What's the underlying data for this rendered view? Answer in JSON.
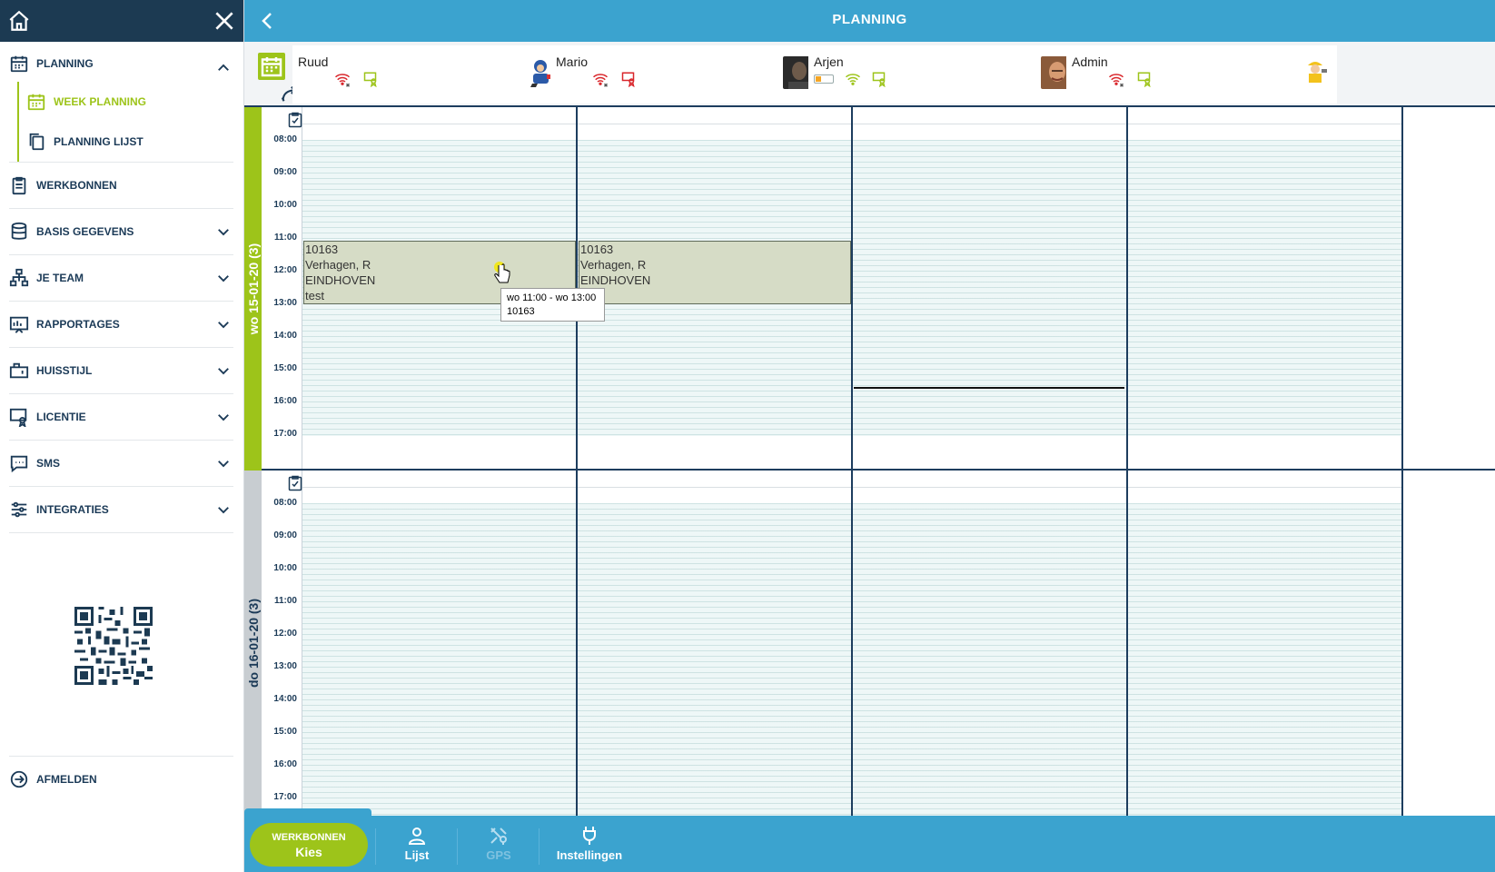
{
  "header": {
    "title": "PLANNING"
  },
  "sidebar": {
    "menu_top": {
      "label": "PLANNING"
    },
    "sub_items": [
      {
        "label": "WEEK PLANNING",
        "active": true
      },
      {
        "label": "PLANNING LIJST",
        "active": false
      }
    ],
    "items": [
      {
        "label": "WERKBONNEN",
        "expandable": false
      },
      {
        "label": "BASIS GEGEVENS",
        "expandable": true
      },
      {
        "label": "JE TEAM",
        "expandable": true
      },
      {
        "label": "RAPPORTAGES",
        "expandable": true
      },
      {
        "label": "HUISSTIJL",
        "expandable": true
      },
      {
        "label": "LICENTIE",
        "expandable": true
      },
      {
        "label": "SMS",
        "expandable": true
      },
      {
        "label": "INTEGRATIES",
        "expandable": true
      }
    ],
    "logout": {
      "label": "AFMELDEN"
    }
  },
  "resources": [
    {
      "name": "Ruud",
      "wifi": "off",
      "device": "red-off",
      "avatar": "cartoon-worker"
    },
    {
      "name": "Mario",
      "wifi": "off",
      "device": "red",
      "avatar": "photo-dark"
    },
    {
      "name": "Arjen",
      "wifi": "on",
      "device": "green",
      "battery": "low",
      "avatar": "photo-face"
    },
    {
      "name": "Admin",
      "wifi": "off",
      "device": "green",
      "avatar": "cartoon-builder"
    }
  ],
  "days": [
    {
      "label": "wo 15-01-20 (3)",
      "color": "#9dc41a",
      "hours": [
        "08:00",
        "09:00",
        "10:00",
        "11:00",
        "12:00",
        "13:00",
        "14:00",
        "15:00",
        "16:00",
        "17:00"
      ]
    },
    {
      "label": "do 16-01-20 (3)",
      "color": "#c8cdd1",
      "hours": [
        "08:00",
        "09:00",
        "10:00",
        "11:00",
        "12:00",
        "13:00",
        "14:00",
        "15:00",
        "16:00",
        "17:00"
      ]
    }
  ],
  "appointments": [
    {
      "lines": [
        "10163",
        "Verhagen, R",
        "EINDHOVEN",
        "test"
      ]
    },
    {
      "lines": [
        "10163",
        "Verhagen, R",
        "EINDHOVEN"
      ]
    }
  ],
  "tooltip": {
    "line1": "wo 11:00 - wo 13:00",
    "line2": "10163"
  },
  "bottom": {
    "pill_line1": "WERKBONNEN",
    "pill_line2": "Kies",
    "tabs": [
      {
        "label": "Lijst",
        "enabled": true
      },
      {
        "label": "GPS",
        "enabled": false
      },
      {
        "label": "Instellingen",
        "enabled": true
      }
    ]
  },
  "colors": {
    "primary": "#3ba3cf",
    "accent": "#9dc41a",
    "navy": "#1c3a52"
  }
}
